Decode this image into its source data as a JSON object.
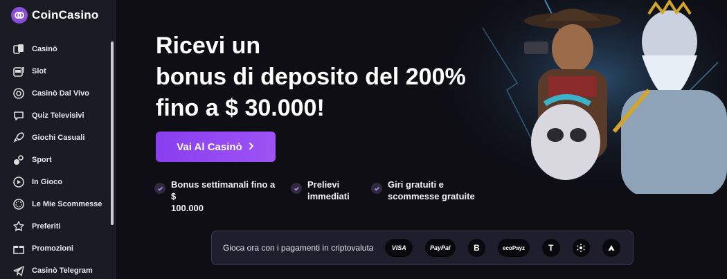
{
  "brand": {
    "name": "CoinCasino"
  },
  "sidebar": {
    "items": [
      {
        "label": "Casinò",
        "icon": "cards-icon"
      },
      {
        "label": "Slot",
        "icon": "slot-machine-icon"
      },
      {
        "label": "Casinò Dal Vivo",
        "icon": "roulette-chip-icon"
      },
      {
        "label": "Quiz Televisivi",
        "icon": "chat-bubble-icon"
      },
      {
        "label": "Giochi Casuali",
        "icon": "rocket-icon"
      },
      {
        "label": "Sport",
        "icon": "sport-icon"
      },
      {
        "label": "In Gioco",
        "icon": "play-icon"
      },
      {
        "label": "Le Mie Scommesse",
        "icon": "coin-icon"
      },
      {
        "label": "Preferiti",
        "icon": "star-icon"
      },
      {
        "label": "Promozioni",
        "icon": "gift-icon"
      },
      {
        "label": "Casinò Telegram",
        "icon": "telegram-icon"
      }
    ]
  },
  "hero": {
    "headline": [
      "Ricevi un",
      "bonus di deposito del 200%",
      "fino a $ 30.000!"
    ],
    "cta_label": "Vai Al Casinò",
    "features": [
      {
        "line1": "Bonus settimanali fino a $",
        "line2": "100.000"
      },
      {
        "line1": "Prelievi",
        "line2": "immediati"
      },
      {
        "line1": "Giri gratuiti e",
        "line2": "scommesse gratuite"
      }
    ]
  },
  "payments": {
    "text": "Gioca ora con i pagamenti in criptovaluta",
    "methods": [
      {
        "label": "VISA",
        "icon": "visa-icon"
      },
      {
        "label": "PayPal",
        "icon": "paypal-icon"
      },
      {
        "label": "B",
        "icon": "bitcoin-icon"
      },
      {
        "label": "ecoPayz",
        "icon": "ecopayz-icon"
      },
      {
        "label": "T",
        "icon": "tether-icon"
      },
      {
        "label": "",
        "icon": "cardano-icon"
      },
      {
        "label": "",
        "icon": "avalanche-icon"
      }
    ]
  },
  "colors": {
    "accent": "#8a3ff0",
    "sidebar_bg": "#1b1b24",
    "page_bg": "#0e0e14"
  }
}
